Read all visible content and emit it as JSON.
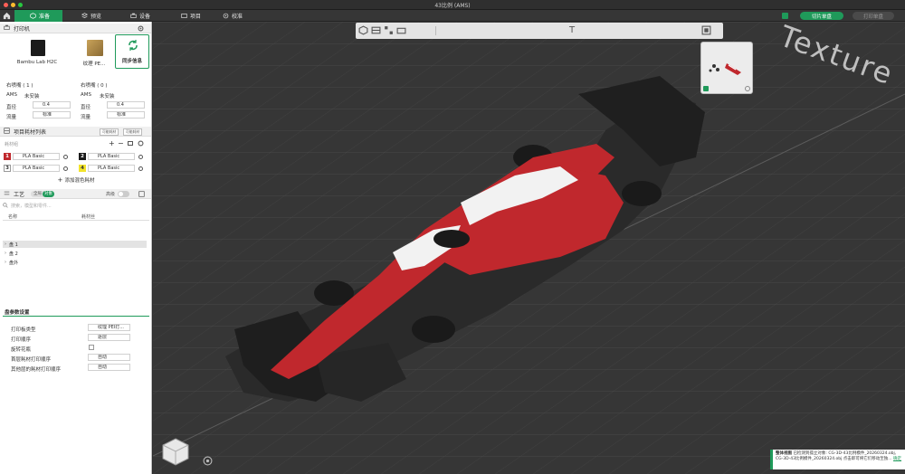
{
  "window": {
    "title": "43比例 (AMS)"
  },
  "nav": {
    "tabs": [
      {
        "label": "准备"
      },
      {
        "label": "预览"
      },
      {
        "label": "设备"
      },
      {
        "label": "项目"
      },
      {
        "label": "校准"
      }
    ],
    "slice_button": "切片单盘",
    "print_button": "打印单盘"
  },
  "printer": {
    "section_title": "打印机",
    "name": "Bambu Lab H2C",
    "plate": "纹理 PE...",
    "sync_label": "同步信息",
    "nozzle_left": {
      "title": "右喷嘴 ( 1 )",
      "ams_label": "AMS",
      "ams_value": "未安装",
      "diameter_label": "直径",
      "diameter_value": "0.4",
      "flow_label": "流量",
      "flow_value": "标准"
    },
    "nozzle_right": {
      "title": "右喷嘴 ( 0 )",
      "ams_label": "AMS",
      "ams_value": "未安装",
      "diameter_label": "直径",
      "diameter_value": "0.4",
      "flow_label": "流量",
      "flow_value": "标准"
    }
  },
  "filaments": {
    "section_title": "项目耗材列表",
    "btn_a": "可能耗材",
    "btn_b": "可能耗材",
    "group_label": "耗材组",
    "items": [
      {
        "num": "1",
        "name": "PLA Basic",
        "color": "#c0282d",
        "text_color": "#ffffff"
      },
      {
        "num": "2",
        "name": "PLA Basic",
        "color": "#1a1a1a",
        "text_color": "#ffffff"
      },
      {
        "num": "3",
        "name": "PLA Basic",
        "color": "#ffffff",
        "text_color": "#333333"
      },
      {
        "num": "4",
        "name": "PLA Basic",
        "color": "#f2e32a",
        "text_color": "#333333"
      }
    ],
    "add_label": "添加混色耗材"
  },
  "process": {
    "section_title": "工艺",
    "toggle_a": "全局",
    "toggle_b": "对象",
    "advanced_label": "高级",
    "search_placeholder": "搜索，模型和零件...",
    "col_name": "名称",
    "col_filament": "耗材丝",
    "tree": [
      "盘 1",
      "盘 2",
      "盘外"
    ]
  },
  "plate_settings": {
    "section_title": "盘参数设置",
    "rows": [
      {
        "label": "打印板类型",
        "value": "纹理 PEI打..."
      },
      {
        "label": "打印顺序",
        "value": "逐层"
      },
      {
        "label": "旋转花瓶",
        "value": ""
      },
      {
        "label": "首层耗材打印顺序",
        "value": "自动"
      },
      {
        "label": "其他层的耗材打印顺序",
        "value": "自动"
      }
    ]
  },
  "viewport": {
    "watermark": "Texture",
    "notification": {
      "title": "整体视图",
      "body": "已检测到孤立对象: CG-3D-43比例模件_20260324.obj, CG-3D-43比例模件_20260324.obj 点击即可将它们移动至独...",
      "link": "确定"
    }
  },
  "colors": {
    "accent": "#1f9a5a",
    "red": "#c0282d"
  }
}
